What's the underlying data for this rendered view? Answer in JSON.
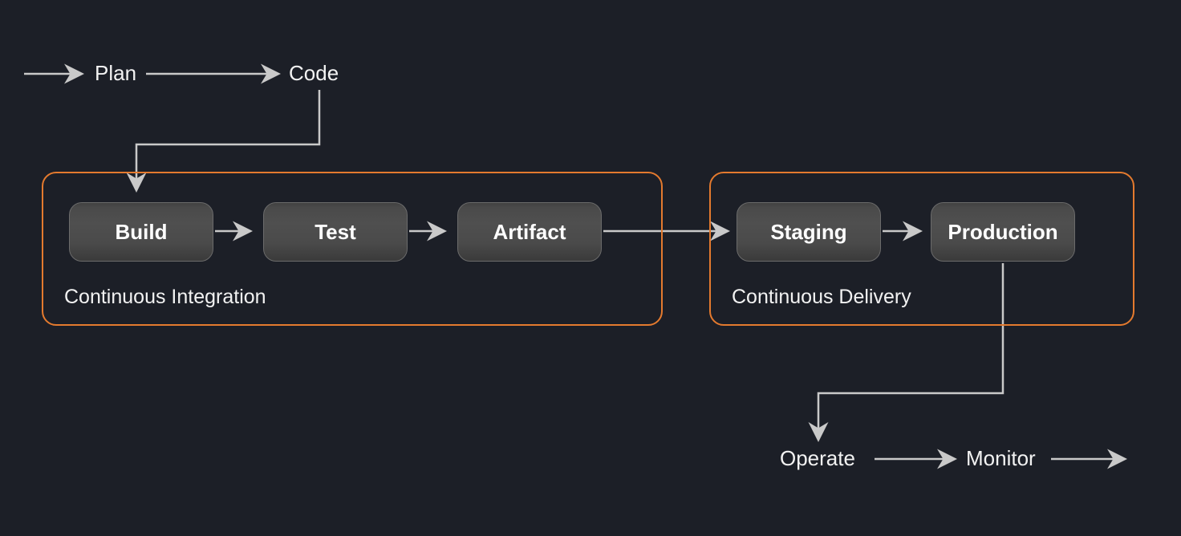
{
  "colors": {
    "background": "#1c1f27",
    "text": "#f2f2f2",
    "node_fill_top": "#4f4f4f",
    "node_fill_bottom": "#3a3a3a",
    "node_border": "#6b6b6b",
    "group_border": "#e47a2e",
    "arrow": "#c9c9c9"
  },
  "top_flow": {
    "plan": "Plan",
    "code": "Code"
  },
  "ci_group": {
    "label": "Continuous Integration",
    "stages": {
      "build": "Build",
      "test": "Test",
      "artifact": "Artifact"
    }
  },
  "cd_group": {
    "label": "Continuous Delivery",
    "stages": {
      "staging": "Staging",
      "production": "Production"
    }
  },
  "bottom_flow": {
    "operate": "Operate",
    "monitor": "Monitor"
  }
}
